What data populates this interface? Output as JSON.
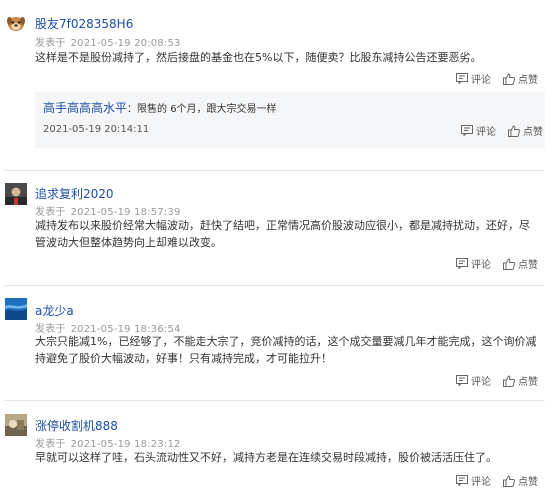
{
  "actions": {
    "comment_label": "评论",
    "like_label": "点赞"
  },
  "comments": [
    {
      "user": "股友7f028358H6",
      "posted_label": "发表于",
      "time": "2021-05-19 20:08:53",
      "text": "这样是不是股份减持了，然后接盘的基金也在5%以下，随便卖？比股东减持公告还要恶劣。",
      "reply": {
        "user": "高手高高高水平",
        "text": "：限售的 6个月，跟大宗交易一样",
        "time": "2021-05-19 20:14:11"
      }
    },
    {
      "user": "追求复利2020",
      "posted_label": "发表于",
      "time": "2021-05-19 18:57:39",
      "text": "减持发布以来股价经常大幅波动，赶快了结吧，正常情况高价股波动应很小，都是减持扰动，还好，尽管波动大但整体趋势向上却难以改变。"
    },
    {
      "user": "a龙少a",
      "posted_label": "发表于",
      "time": "2021-05-19 18:36:54",
      "text": "大宗只能减1%，已经够了，不能走大宗了，竞价减持的话，这个成交量要减几年才能完成，这个询价减持避免了股价大幅波动，好事！只有减持完成，才可能拉升！"
    },
    {
      "user": "涨停收割机888",
      "posted_label": "发表于",
      "time": "2021-05-19 18:23:12",
      "text": "早就可以这样了哇，石头流动性又不好，减持方老是在连续交易时段减持，股价被活活压住了。"
    }
  ]
}
